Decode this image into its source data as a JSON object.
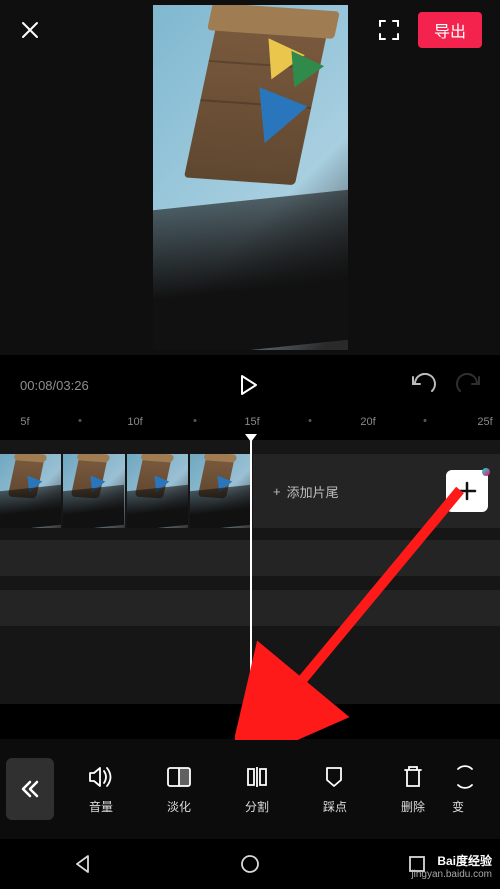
{
  "header": {
    "export_label": "导出"
  },
  "playback": {
    "timecode": "00:08/03:26"
  },
  "ruler": {
    "labels": [
      "5f",
      "10f",
      "15f",
      "20f",
      "25f"
    ]
  },
  "timeline": {
    "add_tail_label": "添加片尾"
  },
  "toolbar": {
    "items": [
      {
        "id": "volume",
        "label": "音量"
      },
      {
        "id": "fade",
        "label": "淡化"
      },
      {
        "id": "split",
        "label": "分割"
      },
      {
        "id": "beat",
        "label": "踩点"
      },
      {
        "id": "delete",
        "label": "删除"
      },
      {
        "id": "transform",
        "label": "变"
      }
    ]
  },
  "watermark": {
    "brand": "Bai度经验",
    "url": "jingyan.baidu.com"
  }
}
